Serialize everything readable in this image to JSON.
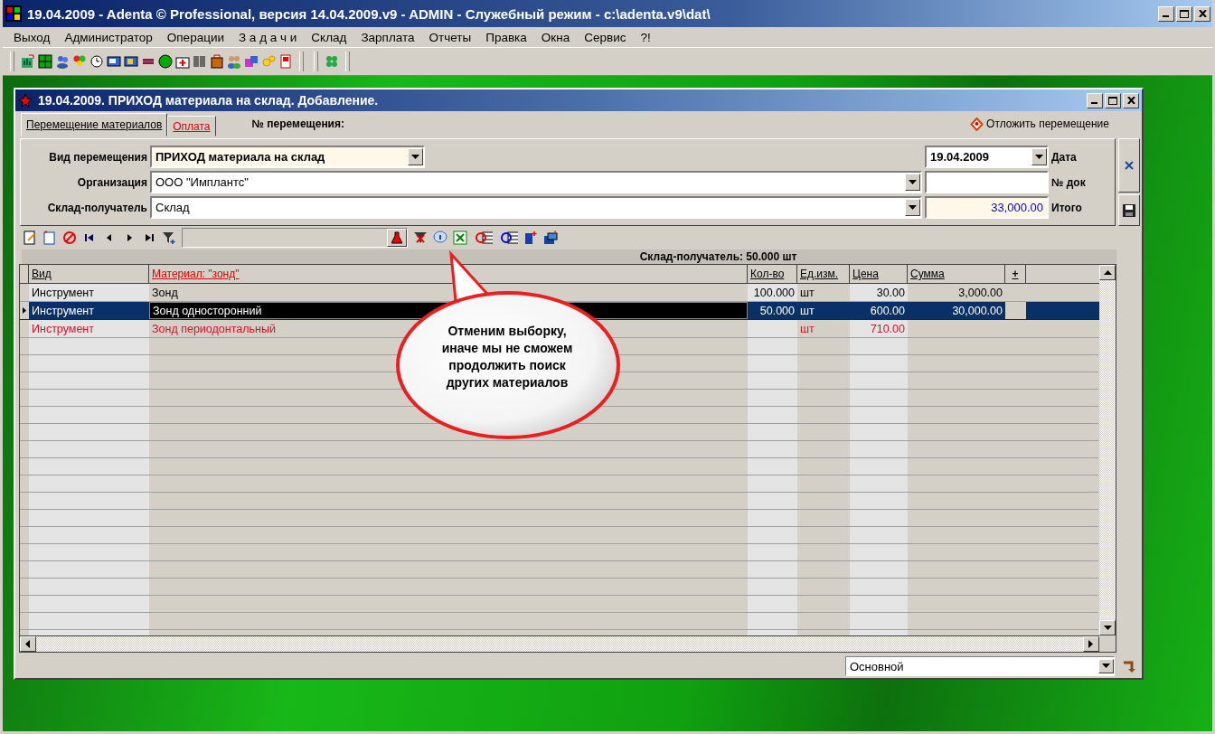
{
  "app_window": {
    "title": "19.04.2009 - Adenta © Professional, версия 14.04.2009.v9 - ADMIN - Служебный режим - c:\\adenta.v9\\dat\\"
  },
  "menu": [
    "Выход",
    "Администратор",
    "Операции",
    "З а д а ч и",
    "Склад",
    "Зарплата",
    "Отчеты",
    "Правка",
    "Окна",
    "Сервис",
    "?!"
  ],
  "document_window": {
    "title": "19.04.2009. ПРИХОД материала на склад. Добавление.",
    "tabs": [
      {
        "label": "Перемещение материалов",
        "selected": true
      },
      {
        "label": "Оплата",
        "selected": false
      }
    ],
    "number_label": "№ перемещения:",
    "postpone_button": "Отложить перемещение",
    "fields": [
      {
        "label": "Вид перемещения",
        "value": "ПРИХОД материала на склад"
      },
      {
        "label": "Организация",
        "value": "ООО \"Имплантс\""
      },
      {
        "label": "Склад-получатель",
        "value": "Склад"
      }
    ],
    "side_fields": [
      {
        "label": "Дата",
        "value": "19.04.2009"
      },
      {
        "label": "№ док"
      },
      {
        "label": "Итого",
        "value": "33,000.00"
      }
    ],
    "grid_caption": "Склад-получатель: 50.000 шт",
    "columns": [
      {
        "title": "Вид",
        "filtered": false
      },
      {
        "title": "Материал: \"зонд\"",
        "filtered": true
      },
      {
        "title": "Кол-во",
        "filtered": false
      },
      {
        "title": "Ед.изм.",
        "filtered": false
      },
      {
        "title": "Цена",
        "filtered": false
      },
      {
        "title": "Сумма",
        "filtered": false
      },
      {
        "title": "+",
        "filtered": false
      }
    ],
    "rows": [
      {
        "cells": [
          "Инструмент",
          "Зонд",
          "100.000",
          "шт",
          "30.00",
          "3,000.00"
        ],
        "selected": false,
        "marked": false
      },
      {
        "cells": [
          "Инструмент",
          "Зонд односторонний",
          "50.000",
          "шт",
          "600.00",
          "30,000.00"
        ],
        "selected": true,
        "marked": false
      },
      {
        "cells": [
          "Инструмент",
          "Зонд периодонтальный",
          "",
          "шт",
          "710.00",
          ""
        ],
        "selected": false,
        "marked": true
      }
    ],
    "callout": "Отменим выборку, иначе мы не сможем продолжить поиск других материалов",
    "view_select": "Основной"
  }
}
